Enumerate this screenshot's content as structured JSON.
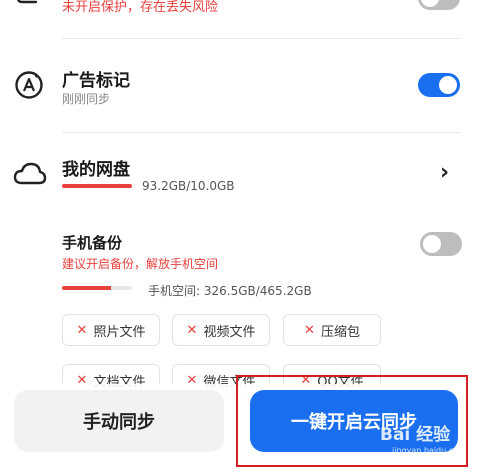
{
  "top_warning": "未开启保护，存在丢失风险",
  "ad_mark": {
    "title": "广告标记",
    "subtitle": "刚刚同步",
    "toggle_on": true,
    "icon": "ad-badge-icon"
  },
  "cloud_drive": {
    "title": "我的网盘",
    "usage": "93.2GB/10.0GB",
    "usage_fraction": 1.0,
    "icon": "cloud-icon",
    "arrow": "›"
  },
  "phone_backup": {
    "title": "手机备份",
    "warning": "建议开启备份，解放手机空间",
    "toggle_on": false,
    "storage": "手机空间: 326.5GB/465.2GB",
    "storage_fraction": 0.7
  },
  "chips": [
    {
      "label": "照片文件"
    },
    {
      "label": "视频文件"
    },
    {
      "label": "压缩包"
    },
    {
      "label": "文档文件"
    },
    {
      "label": "微信文件"
    },
    {
      "label": "QQ文件"
    }
  ],
  "chip_mark": "✕",
  "buttons": {
    "manual_sync": "手动同步",
    "one_key_cloud": "一键开启云同步"
  },
  "watermark": {
    "text": "Bai 经验",
    "url": "jingyan.baidu.com"
  },
  "colors": {
    "accent": "#1a6ff0",
    "warning": "#e8413d",
    "highlight_box": "#d71e1e"
  }
}
